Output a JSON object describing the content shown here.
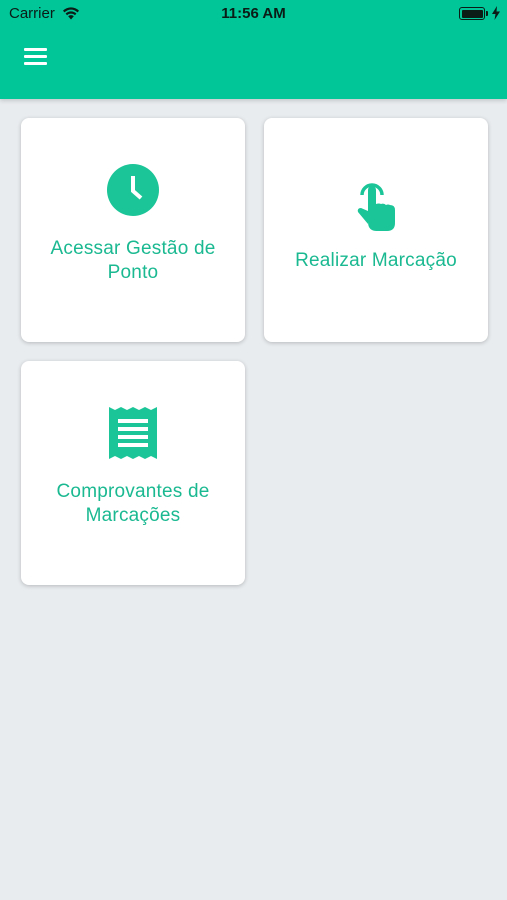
{
  "status_bar": {
    "carrier": "Carrier",
    "time": "11:56 AM",
    "battery_level": 1.0
  },
  "header": {
    "menu_icon": "hamburger-menu-icon",
    "background_color": "#00c698"
  },
  "cards": [
    {
      "icon": "clock-icon",
      "label_line1": "Acessar Gestão de",
      "label_line2": "Ponto"
    },
    {
      "icon": "touch-hand-icon",
      "label": "Realizar Marcação"
    },
    {
      "icon": "receipt-icon",
      "label_line1": "Comprovantes de",
      "label_line2": "Marcações"
    }
  ],
  "colors": {
    "accent": "#00c698",
    "label_text": "#1bb991",
    "background": "#e9ecef"
  }
}
